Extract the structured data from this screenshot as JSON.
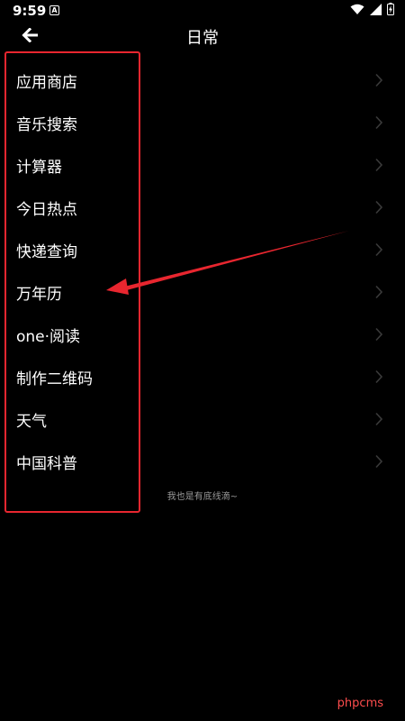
{
  "status_bar": {
    "time": "9:59",
    "notification_icon": "a-notification-icon",
    "icons": [
      "wifi-icon",
      "cellular-signal-icon",
      "battery-icon"
    ]
  },
  "header": {
    "title": "日常",
    "back_icon": "arrow-left-icon"
  },
  "menu": {
    "items": [
      {
        "label": "应用商店"
      },
      {
        "label": "音乐搜索"
      },
      {
        "label": "计算器"
      },
      {
        "label": "今日热点"
      },
      {
        "label": "快递查询"
      },
      {
        "label": "万年历"
      },
      {
        "label": "one·阅读"
      },
      {
        "label": "制作二维码"
      },
      {
        "label": "天气"
      },
      {
        "label": "中国科普"
      }
    ],
    "chevron_icon": "chevron-right-icon"
  },
  "footer": {
    "end_note": "我也是有底线滴~"
  },
  "annotation": {
    "highlight_color": "#e8262f",
    "arrow_icon": "red-arrow-pointer",
    "watermark": "phpcms"
  }
}
